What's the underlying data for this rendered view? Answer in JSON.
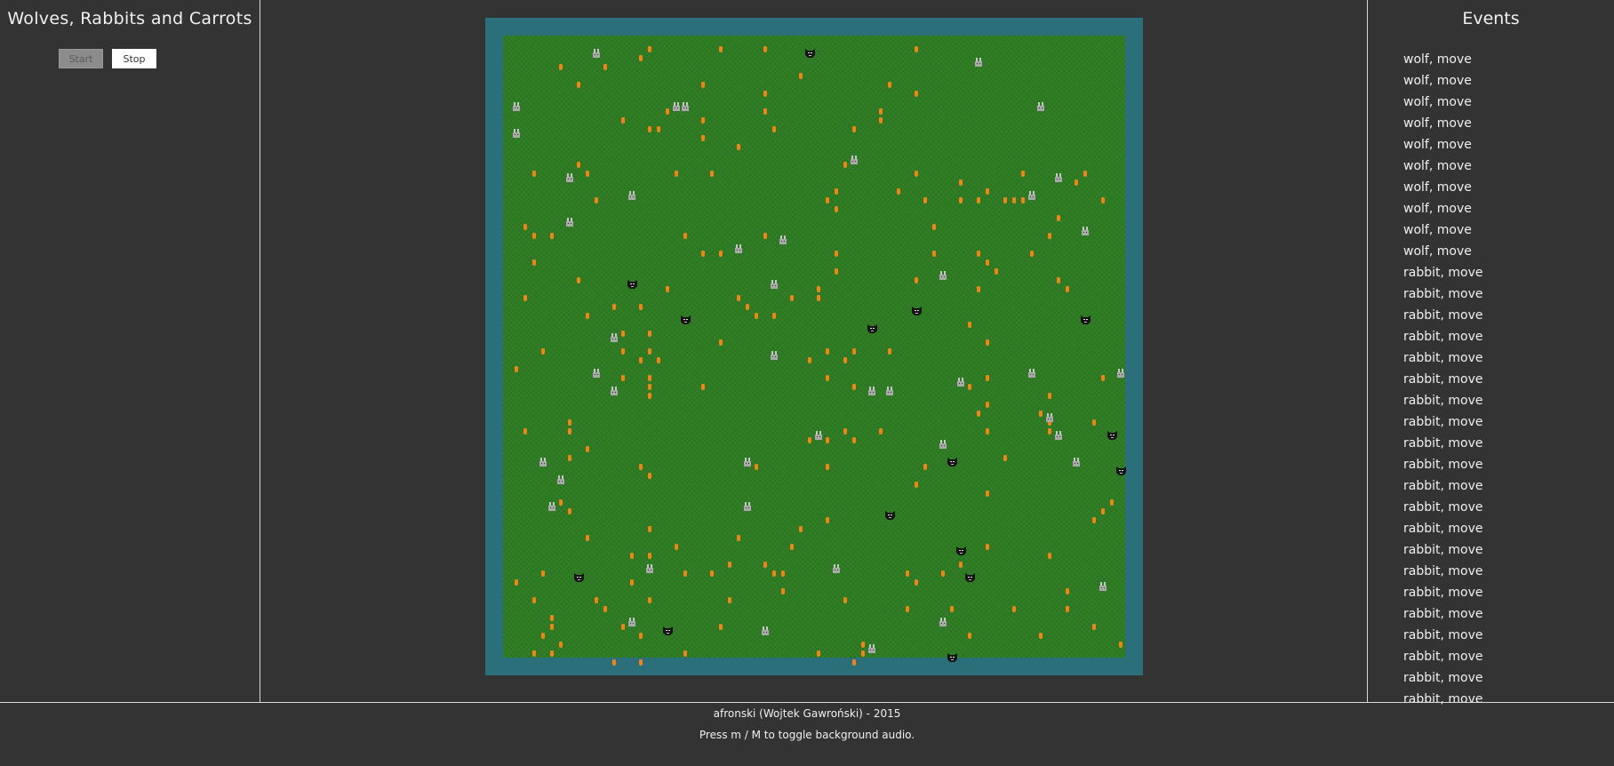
{
  "app": {
    "title": "Wolves, Rabbits and Carrots",
    "start_label": "Start",
    "stop_label": "Stop"
  },
  "events": {
    "title": "Events",
    "items": [
      "wolf, move",
      "wolf, move",
      "wolf, move",
      "wolf, move",
      "wolf, move",
      "wolf, move",
      "wolf, move",
      "wolf, move",
      "wolf, move",
      "wolf, move",
      "rabbit, move",
      "rabbit, move",
      "rabbit, move",
      "rabbit, move",
      "rabbit, move",
      "rabbit, move",
      "rabbit, move",
      "rabbit, move",
      "rabbit, move",
      "rabbit, move",
      "rabbit, move",
      "rabbit, move",
      "rabbit, move",
      "rabbit, move",
      "rabbit, move",
      "rabbit, move",
      "rabbit, move",
      "rabbit, move",
      "rabbit, move",
      "rabbit, move",
      "rabbit, move"
    ]
  },
  "board": {
    "columns": 70,
    "rows": 70,
    "colors": {
      "frame": "#2a6f7a",
      "grass": "#2d7c22",
      "carrot": "#f08417",
      "rabbit": "#b8b8b8",
      "wolf": "#1a1a1a"
    },
    "wolves": [
      [
        34,
        1
      ],
      [
        14,
        27
      ],
      [
        20,
        31
      ],
      [
        41,
        32
      ],
      [
        46,
        30
      ],
      [
        65,
        31
      ],
      [
        68,
        44
      ],
      [
        50,
        47
      ],
      [
        69,
        48
      ],
      [
        43,
        53
      ],
      [
        51,
        57
      ],
      [
        8,
        60
      ],
      [
        52,
        60
      ],
      [
        18,
        66
      ],
      [
        50,
        69
      ]
    ],
    "rabbits": [
      [
        10,
        1
      ],
      [
        53,
        2
      ],
      [
        1,
        7
      ],
      [
        19,
        7
      ],
      [
        20,
        7
      ],
      [
        60,
        7
      ],
      [
        1,
        10
      ],
      [
        39,
        13
      ],
      [
        7,
        15
      ],
      [
        62,
        15
      ],
      [
        14,
        17
      ],
      [
        59,
        17
      ],
      [
        7,
        20
      ],
      [
        65,
        21
      ],
      [
        31,
        22
      ],
      [
        26,
        23
      ],
      [
        49,
        26
      ],
      [
        30,
        27
      ],
      [
        12,
        33
      ],
      [
        30,
        35
      ],
      [
        10,
        37
      ],
      [
        59,
        37
      ],
      [
        69,
        37
      ],
      [
        51,
        38
      ],
      [
        12,
        39
      ],
      [
        41,
        39
      ],
      [
        43,
        39
      ],
      [
        61,
        42
      ],
      [
        35,
        44
      ],
      [
        62,
        44
      ],
      [
        49,
        45
      ],
      [
        4,
        47
      ],
      [
        27,
        47
      ],
      [
        64,
        47
      ],
      [
        6,
        49
      ],
      [
        5,
        52
      ],
      [
        27,
        52
      ],
      [
        16,
        59
      ],
      [
        37,
        59
      ],
      [
        67,
        61
      ],
      [
        14,
        65
      ],
      [
        49,
        65
      ],
      [
        29,
        66
      ],
      [
        41,
        68
      ]
    ],
    "carrots": [
      [
        16,
        1
      ],
      [
        24,
        1
      ],
      [
        29,
        1
      ],
      [
        46,
        1
      ],
      [
        15,
        2
      ],
      [
        6,
        3
      ],
      [
        11,
        3
      ],
      [
        33,
        4
      ],
      [
        8,
        5
      ],
      [
        22,
        5
      ],
      [
        43,
        5
      ],
      [
        29,
        6
      ],
      [
        46,
        6
      ],
      [
        18,
        8
      ],
      [
        29,
        8
      ],
      [
        42,
        8
      ],
      [
        13,
        9
      ],
      [
        22,
        9
      ],
      [
        42,
        9
      ],
      [
        16,
        10
      ],
      [
        17,
        10
      ],
      [
        30,
        10
      ],
      [
        39,
        10
      ],
      [
        22,
        11
      ],
      [
        26,
        12
      ],
      [
        8,
        14
      ],
      [
        38,
        14
      ],
      [
        3,
        15
      ],
      [
        9,
        15
      ],
      [
        19,
        15
      ],
      [
        23,
        15
      ],
      [
        46,
        15
      ],
      [
        58,
        15
      ],
      [
        65,
        15
      ],
      [
        51,
        16
      ],
      [
        64,
        16
      ],
      [
        37,
        17
      ],
      [
        44,
        17
      ],
      [
        54,
        17
      ],
      [
        10,
        18
      ],
      [
        36,
        18
      ],
      [
        47,
        18
      ],
      [
        51,
        18
      ],
      [
        53,
        18
      ],
      [
        56,
        18
      ],
      [
        57,
        18
      ],
      [
        58,
        18
      ],
      [
        67,
        18
      ],
      [
        37,
        19
      ],
      [
        62,
        20
      ],
      [
        2,
        21
      ],
      [
        48,
        21
      ],
      [
        3,
        22
      ],
      [
        5,
        22
      ],
      [
        20,
        22
      ],
      [
        29,
        22
      ],
      [
        61,
        22
      ],
      [
        22,
        24
      ],
      [
        24,
        24
      ],
      [
        37,
        24
      ],
      [
        48,
        24
      ],
      [
        53,
        24
      ],
      [
        59,
        24
      ],
      [
        3,
        25
      ],
      [
        54,
        25
      ],
      [
        37,
        26
      ],
      [
        55,
        26
      ],
      [
        8,
        27
      ],
      [
        46,
        27
      ],
      [
        62,
        27
      ],
      [
        18,
        28
      ],
      [
        35,
        28
      ],
      [
        53,
        28
      ],
      [
        63,
        28
      ],
      [
        2,
        29
      ],
      [
        26,
        29
      ],
      [
        32,
        29
      ],
      [
        35,
        29
      ],
      [
        12,
        30
      ],
      [
        15,
        30
      ],
      [
        27,
        30
      ],
      [
        9,
        31
      ],
      [
        28,
        31
      ],
      [
        30,
        31
      ],
      [
        52,
        32
      ],
      [
        13,
        33
      ],
      [
        16,
        33
      ],
      [
        24,
        34
      ],
      [
        54,
        34
      ],
      [
        4,
        35
      ],
      [
        13,
        35
      ],
      [
        16,
        35
      ],
      [
        36,
        35
      ],
      [
        39,
        35
      ],
      [
        43,
        35
      ],
      [
        15,
        36
      ],
      [
        17,
        36
      ],
      [
        34,
        36
      ],
      [
        38,
        36
      ],
      [
        1,
        37
      ],
      [
        13,
        38
      ],
      [
        16,
        38
      ],
      [
        36,
        38
      ],
      [
        54,
        38
      ],
      [
        67,
        38
      ],
      [
        16,
        39
      ],
      [
        22,
        39
      ],
      [
        39,
        39
      ],
      [
        52,
        39
      ],
      [
        16,
        40
      ],
      [
        61,
        40
      ],
      [
        54,
        41
      ],
      [
        53,
        42
      ],
      [
        60,
        42
      ],
      [
        7,
        43
      ],
      [
        61,
        43
      ],
      [
        66,
        43
      ],
      [
        2,
        44
      ],
      [
        7,
        44
      ],
      [
        38,
        44
      ],
      [
        42,
        44
      ],
      [
        54,
        44
      ],
      [
        61,
        44
      ],
      [
        34,
        45
      ],
      [
        36,
        45
      ],
      [
        39,
        45
      ],
      [
        9,
        46
      ],
      [
        7,
        47
      ],
      [
        56,
        47
      ],
      [
        15,
        48
      ],
      [
        28,
        48
      ],
      [
        36,
        48
      ],
      [
        47,
        48
      ],
      [
        16,
        49
      ],
      [
        46,
        50
      ],
      [
        54,
        51
      ],
      [
        6,
        52
      ],
      [
        68,
        52
      ],
      [
        7,
        53
      ],
      [
        67,
        53
      ],
      [
        36,
        54
      ],
      [
        66,
        54
      ],
      [
        16,
        55
      ],
      [
        33,
        55
      ],
      [
        9,
        56
      ],
      [
        26,
        56
      ],
      [
        19,
        57
      ],
      [
        32,
        57
      ],
      [
        54,
        57
      ],
      [
        14,
        58
      ],
      [
        16,
        58
      ],
      [
        61,
        58
      ],
      [
        25,
        59
      ],
      [
        29,
        59
      ],
      [
        51,
        59
      ],
      [
        4,
        60
      ],
      [
        20,
        60
      ],
      [
        23,
        60
      ],
      [
        30,
        60
      ],
      [
        31,
        60
      ],
      [
        45,
        60
      ],
      [
        49,
        60
      ],
      [
        1,
        61
      ],
      [
        14,
        61
      ],
      [
        46,
        61
      ],
      [
        31,
        62
      ],
      [
        63,
        62
      ],
      [
        3,
        63
      ],
      [
        10,
        63
      ],
      [
        25,
        63
      ],
      [
        38,
        63
      ],
      [
        16,
        63
      ],
      [
        11,
        64
      ],
      [
        45,
        64
      ],
      [
        50,
        64
      ],
      [
        57,
        64
      ],
      [
        63,
        64
      ],
      [
        5,
        65
      ],
      [
        5,
        66
      ],
      [
        13,
        66
      ],
      [
        24,
        66
      ],
      [
        66,
        66
      ],
      [
        52,
        67
      ],
      [
        60,
        67
      ],
      [
        4,
        67
      ],
      [
        15,
        67
      ],
      [
        6,
        68
      ],
      [
        69,
        68
      ],
      [
        40,
        68
      ],
      [
        3,
        69
      ],
      [
        20,
        69
      ],
      [
        35,
        69
      ],
      [
        5,
        69
      ],
      [
        39,
        70
      ],
      [
        12,
        70
      ],
      [
        15,
        70
      ],
      [
        40,
        69
      ]
    ]
  },
  "footer": {
    "credit": "afronski (Wojtek Gawroński) - 2015",
    "hint": "Press m / M to toggle background audio."
  }
}
